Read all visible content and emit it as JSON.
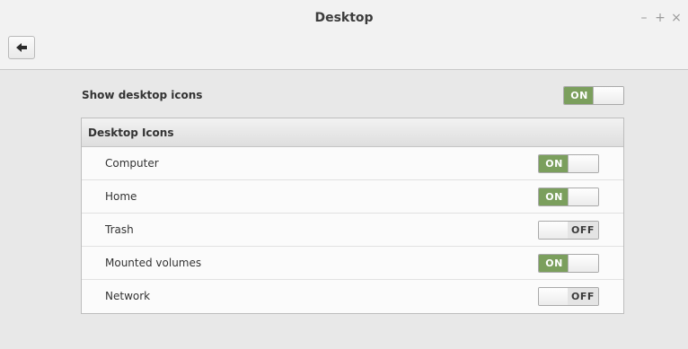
{
  "window": {
    "title": "Desktop",
    "controls": {
      "minimize": "–",
      "maximize": "+",
      "close": "×"
    }
  },
  "toolbar": {
    "back_icon": "back-arrow-icon"
  },
  "main_toggle": {
    "label": "Show desktop icons",
    "state": "ON",
    "on": true
  },
  "section": {
    "title": "Desktop Icons",
    "items": [
      {
        "label": "Computer",
        "state": "ON",
        "on": true
      },
      {
        "label": "Home",
        "state": "ON",
        "on": true
      },
      {
        "label": "Trash",
        "state": "OFF",
        "on": false
      },
      {
        "label": "Mounted volumes",
        "state": "ON",
        "on": true
      },
      {
        "label": "Network",
        "state": "OFF",
        "on": false
      }
    ]
  },
  "colors": {
    "on_accent": "#7b9f5d",
    "window_bg": "#e8e8e8"
  }
}
